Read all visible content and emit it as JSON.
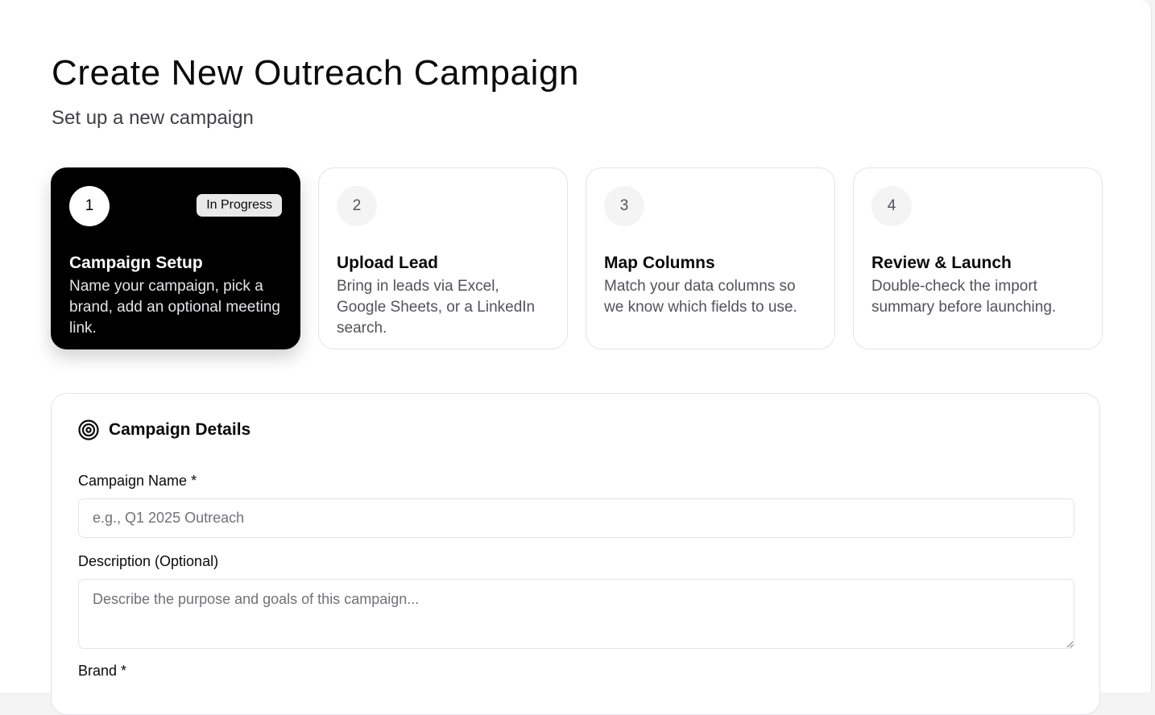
{
  "header": {
    "title": "Create New Outreach Campaign",
    "subtitle": "Set up a new campaign"
  },
  "steps": [
    {
      "number": "1",
      "title": "Campaign Setup",
      "description": "Name your campaign, pick a brand, add an optional meeting link.",
      "status": "In Progress",
      "active": true
    },
    {
      "number": "2",
      "title": "Upload Lead",
      "description": "Bring in leads via Excel, Google Sheets, or a LinkedIn search.",
      "active": false
    },
    {
      "number": "3",
      "title": "Map Columns",
      "description": "Match your data columns so we know which fields to use.",
      "active": false
    },
    {
      "number": "4",
      "title": "Review & Launch",
      "description": "Double-check the import summary before launching.",
      "active": false
    }
  ],
  "details": {
    "icon": "target-icon",
    "title": "Campaign Details",
    "name_label": "Campaign Name *",
    "name_placeholder": "e.g., Q1 2025 Outreach",
    "name_value": "",
    "description_label": "Description (Optional)",
    "description_placeholder": "Describe the purpose and goals of this campaign...",
    "description_value": "",
    "next_label": "Brand *"
  },
  "colors": {
    "active_step_bg": "#000000",
    "border": "#e4e4e7",
    "muted_text": "#52525b"
  }
}
